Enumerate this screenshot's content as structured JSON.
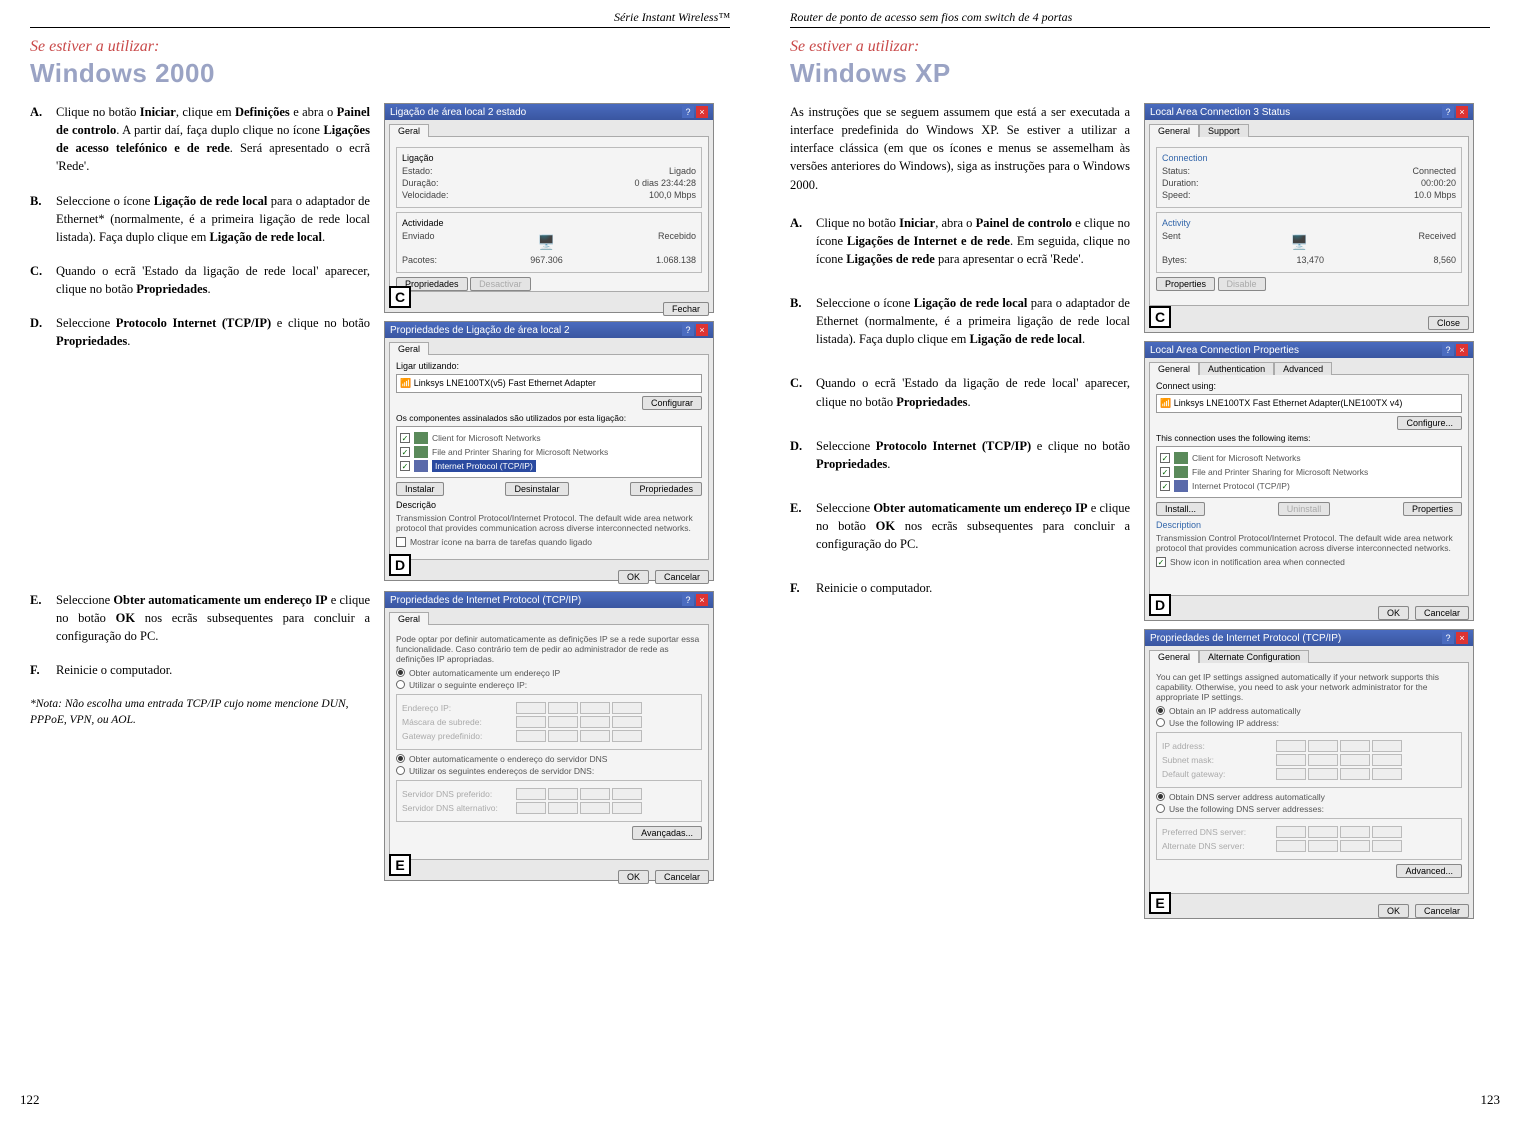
{
  "left": {
    "header": "Série Instant Wireless™",
    "intro_red": "Se estiver a utilizar:",
    "intro_title": "Windows 2000",
    "steps": {
      "A": {
        "letter": "A.",
        "text": "Clique no botão <strong>Iniciar</strong>, clique em <strong>Definições</strong> e abra o <strong>Painel de controlo</strong>.  A partir daí, faça duplo clique no ícone <strong>Ligações de acesso telefónico e de rede</strong>. Será apresentado o ecrã 'Rede'."
      },
      "B": {
        "letter": "B.",
        "text": "Seleccione o ícone <strong>Ligação de rede local</strong> para o adaptador de Ethernet* (normalmente, é a primeira ligação de rede local listada). Faça duplo clique em <strong>Ligação de rede local</strong>."
      },
      "C": {
        "letter": "C.",
        "text": "Quando o ecrã 'Estado da ligação de rede local' aparecer, clique no botão <strong>Propriedades</strong>."
      },
      "D": {
        "letter": "D.",
        "text": "Seleccione <strong>Protocolo Internet (TCP/IP)</strong> e clique no botão <strong>Propriedades</strong>."
      },
      "E": {
        "letter": "E.",
        "text": "Seleccione <strong>Obter automaticamente um endereço IP</strong> e clique no botão <strong>OK</strong> nos ecrãs subsequentes para concluir a configuração do PC."
      },
      "F": {
        "letter": "F.",
        "text": "Reinicie o computador."
      }
    },
    "note": "*Nota: Não escolha uma entrada TCP/IP cujo nome mencione DUN, PPPoE, VPN, ou AOL.",
    "page_num": "122",
    "mockC": {
      "title": "Ligação de área local 2 estado",
      "tab": "Geral",
      "sec1": "Ligação",
      "r1a": "Estado:",
      "r1b": "Ligado",
      "r2a": "Duração:",
      "r2b": "0 dias 23:44:28",
      "r3a": "Velocidade:",
      "r3b": "100,0 Mbps",
      "sec2": "Actividade",
      "r4a": "Enviado",
      "r4b": "Recebido",
      "r5a": "Pacotes:",
      "r5b": "967.306",
      "r5c": "1.068.138",
      "b1": "Propriedades",
      "b2": "Desactivar",
      "b3": "Fechar",
      "label": "C"
    },
    "mockD": {
      "title": "Propriedades de Ligação de área local 2",
      "tab": "Geral",
      "l1": "Ligar utilizando:",
      "adapter": "Linksys LNE100TX(v5) Fast Ethernet Adapter",
      "bcfg": "Configurar",
      "l2": "Os componentes assinalados são utilizados por esta ligação:",
      "i1": "Client for Microsoft Networks",
      "i2": "File and Printer Sharing for Microsoft Networks",
      "i3": "Internet Protocol (TCP/IP)",
      "b1": "Instalar",
      "b2": "Desinstalar",
      "b3": "Propriedades",
      "dsc_t": "Descrição",
      "dsc": "Transmission Control Protocol/Internet Protocol. The default wide area network protocol that provides communication across diverse interconnected networks.",
      "chk": "Mostrar ícone na barra de tarefas quando ligado",
      "ok": "OK",
      "cancel": "Cancelar",
      "label": "D"
    },
    "mockE": {
      "title": "Propriedades de Internet Protocol (TCP/IP)",
      "tab": "Geral",
      "desc": "Pode optar por definir automaticamente as definições IP se a rede suportar essa funcionalidade. Caso contrário tem de pedir ao administrador de rede as definições IP apropriadas.",
      "r1": "Obter automaticamente um endereço IP",
      "r2": "Utilizar o seguinte endereço IP:",
      "f1": "Endereço IP:",
      "f2": "Máscara de subrede:",
      "f3": "Gateway predefinido:",
      "r3": "Obter automaticamente o endereço do servidor DNS",
      "r4": "Utilizar os seguintes endereços de servidor DNS:",
      "f4": "Servidor DNS preferido:",
      "f5": "Servidor DNS alternativo:",
      "adv": "Avançadas...",
      "ok": "OK",
      "cancel": "Cancelar",
      "label": "E"
    }
  },
  "right": {
    "header": "Router de ponto de acesso sem fios com switch de 4 portas",
    "intro_red": "Se estiver a utilizar:",
    "intro_title": "Windows XP",
    "intro_para": "As instruções que se seguem assumem que está a ser executada a interface predefinida do Windows XP. Se estiver a utilizar a interface clássica (em que os ícones e menus se assemelham às versões anteriores do Windows), siga as instruções para o Windows 2000.",
    "steps": {
      "A": {
        "letter": "A.",
        "text": "Clique no botão <strong>Iniciar</strong>, abra o <strong>Painel de controlo</strong> e clique no ícone <strong>Ligações de Internet e de rede</strong>. Em seguida, clique no ícone <strong>Ligações de rede</strong> para apresentar o ecrã 'Rede'."
      },
      "B": {
        "letter": "B.",
        "text": "Seleccione o ícone <strong>Ligação de rede local</strong> para o adaptador de Ethernet (normalmente, é a primeira ligação de rede local listada). Faça duplo clique em <strong>Ligação de rede local</strong>."
      },
      "C": {
        "letter": "C.",
        "text": "Quando o ecrã 'Estado da ligação de rede local' aparecer, clique no botão <strong>Propriedades</strong>."
      },
      "D": {
        "letter": "D.",
        "text": "Seleccione <strong>Protocolo Internet (TCP/IP)</strong> e clique no botão <strong>Propriedades</strong>."
      },
      "E": {
        "letter": "E.",
        "text": "Seleccione <strong>Obter automaticamente um endereço IP</strong> e clique no botão <strong>OK</strong> nos ecrãs subsequentes para concluir a configuração do PC."
      },
      "F": {
        "letter": "F.",
        "text": "Reinicie o computador."
      }
    },
    "page_num": "123",
    "mockC": {
      "title": "Local Area Connection 3 Status",
      "t1": "General",
      "t2": "Support",
      "sec1": "Connection",
      "r1a": "Status:",
      "r1b": "Connected",
      "r2a": "Duration:",
      "r2b": "00:00:20",
      "r3a": "Speed:",
      "r3b": "10.0 Mbps",
      "sec2": "Activity",
      "r4a": "Sent",
      "r4b": "Received",
      "r5a": "Bytes:",
      "r5b": "13,470",
      "r5c": "8,560",
      "b1": "Properties",
      "b2": "Disable",
      "b3": "Close",
      "label": "C"
    },
    "mockD": {
      "title": "Local Area Connection  Properties",
      "t1": "General",
      "t2": "Authentication",
      "t3": "Advanced",
      "l1": "Connect using:",
      "adapter": "Linksys LNE100TX Fast Ethernet Adapter(LNE100TX v4)",
      "bcfg": "Configure...",
      "l2": "This connection uses the following items:",
      "i1": "Client for Microsoft Networks",
      "i2": "File and Printer Sharing for Microsoft Networks",
      "i3": "Internet Protocol (TCP/IP)",
      "b1": "Install...",
      "b2": "Uninstall",
      "b3": "Properties",
      "dsc_t": "Description",
      "dsc": "Transmission Control Protocol/Internet Protocol. The default wide area network protocol that provides communication across diverse interconnected networks.",
      "chk": "Show icon in notification area when connected",
      "ok": "OK",
      "cancel": "Cancelar",
      "label": "D"
    },
    "mockE": {
      "title": "Propriedades de Internet Protocol (TCP/IP)",
      "t1": "General",
      "t2": "Alternate Configuration",
      "desc": "You can get IP settings assigned automatically if your network supports this capability. Otherwise, you need to ask your network administrator for the appropriate IP settings.",
      "r1": "Obtain an IP address automatically",
      "r2": "Use the following IP address:",
      "f1": "IP address:",
      "f2": "Subnet mask:",
      "f3": "Default gateway:",
      "r3": "Obtain DNS server address automatically",
      "r4": "Use the following DNS server addresses:",
      "f4": "Preferred DNS server:",
      "f5": "Alternate DNS server:",
      "adv": "Advanced...",
      "ok": "OK",
      "cancel": "Cancelar",
      "label": "E"
    }
  }
}
